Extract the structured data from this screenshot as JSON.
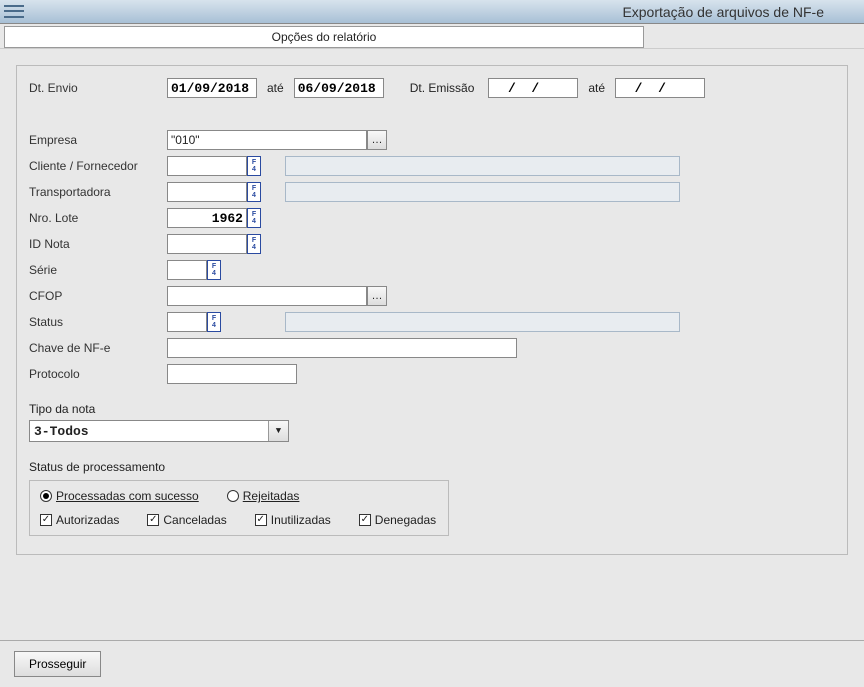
{
  "window": {
    "title": "Exportação de arquivos de NF-e"
  },
  "tab": {
    "label": "Opções do relatório"
  },
  "fields": {
    "dt_envio_label": "Dt. Envio",
    "dt_envio_from": "01/09/2018",
    "ate1": "até",
    "dt_envio_to": "06/09/2018",
    "dt_emissao_label": "Dt. Emissão",
    "dt_emissao_from": "  /  /",
    "ate2": "até",
    "dt_emissao_to": "  /  /",
    "empresa_label": "Empresa",
    "empresa_value": "\"010\"",
    "cliente_label": "Cliente / Fornecedor",
    "transp_label": "Transportadora",
    "lote_label": "Nro. Lote",
    "lote_value": "1962",
    "idnota_label": "ID Nota",
    "serie_label": "Série",
    "cfop_label": "CFOP",
    "status_label": "Status",
    "chave_label": "Chave de NF-e",
    "protocolo_label": "Protocolo",
    "tipo_label": "Tipo da nota",
    "tipo_value": "3-Todos",
    "stproc_label": "Status de processamento",
    "radio_proc": "Processadas com sucesso",
    "radio_rej": "Rejeitadas",
    "chk_aut": "Autorizadas",
    "chk_can": "Canceladas",
    "chk_inu": "Inutilizadas",
    "chk_den": "Denegadas"
  },
  "footer": {
    "prosseguir": "Prosseguir"
  }
}
